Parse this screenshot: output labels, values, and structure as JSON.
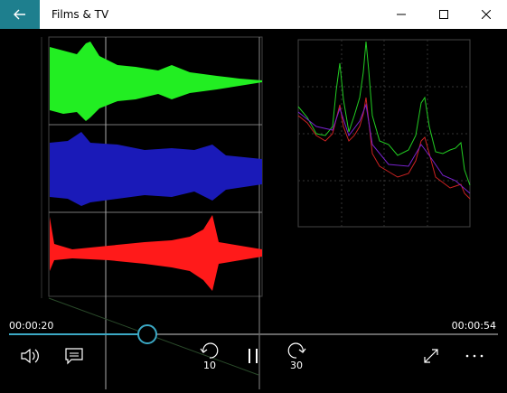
{
  "app": {
    "title": "Films & TV"
  },
  "player": {
    "elapsed": "00:00:20",
    "total": "00:00:54",
    "progress_fraction": 0.28,
    "skip_back_seconds": "10",
    "skip_forward_seconds": "30"
  },
  "colors": {
    "accent": "#1e7f8e",
    "seek": "#3ba8c4"
  },
  "icons": [
    "back-arrow-icon",
    "minimize-icon",
    "maximize-icon",
    "close-icon",
    "volume-icon",
    "subtitles-icon",
    "skip-back-icon",
    "pause-icon",
    "skip-forward-icon",
    "fullscreen-icon",
    "more-icon"
  ]
}
